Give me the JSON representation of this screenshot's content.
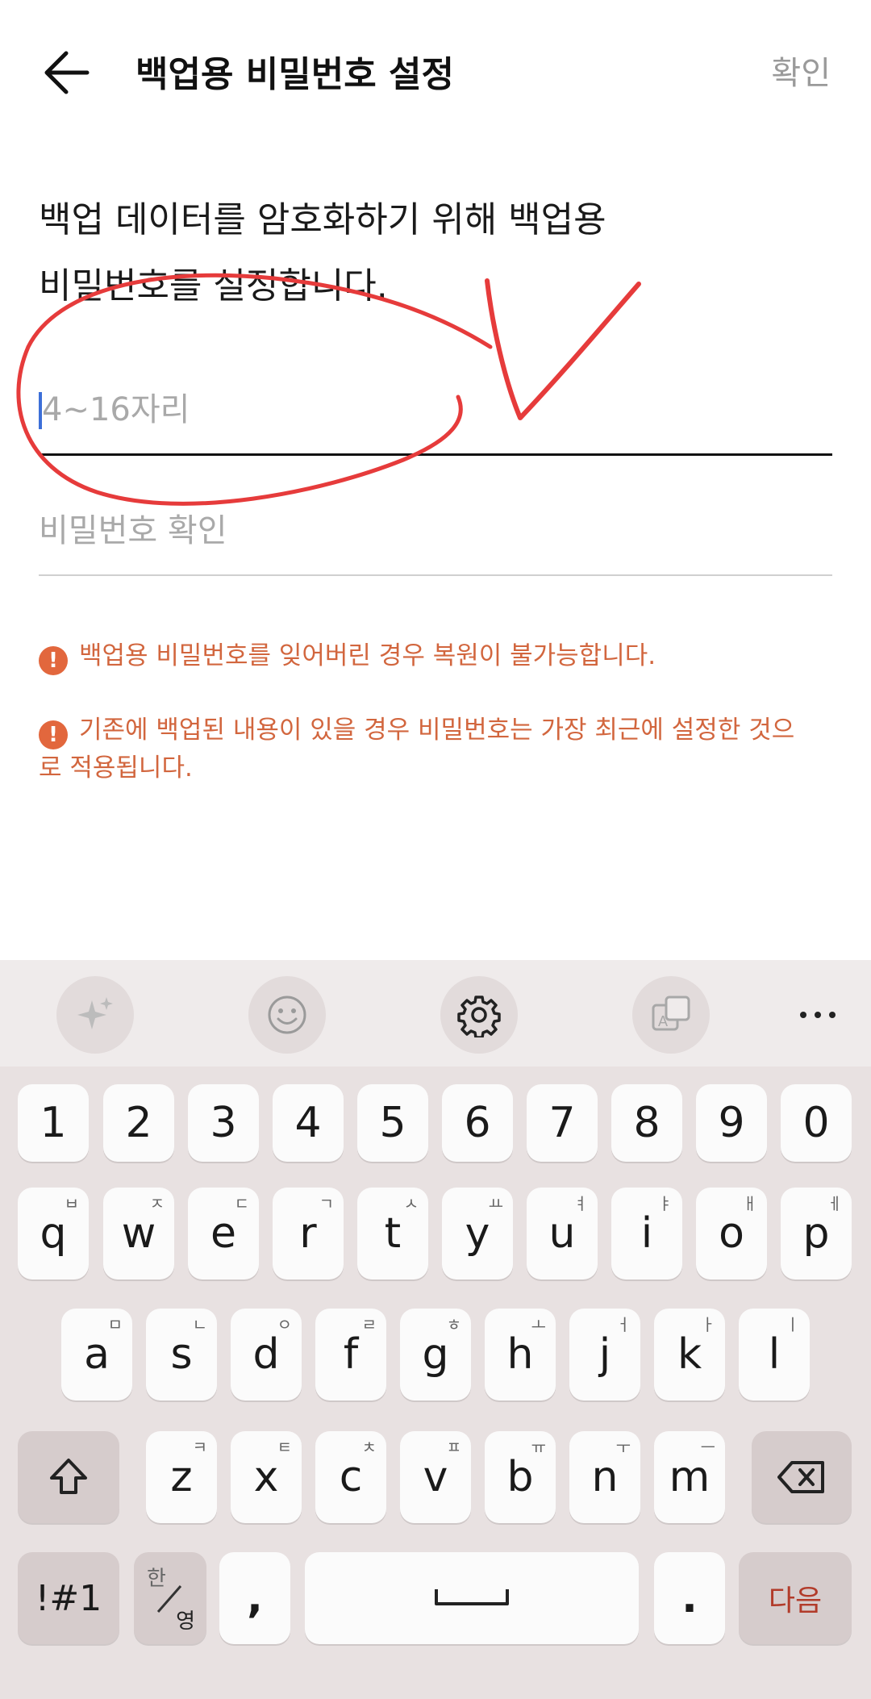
{
  "header": {
    "title": "백업용 비밀번호 설정",
    "confirm_label": "확인",
    "back_icon": "arrow-left-icon"
  },
  "description": {
    "line1": "백업 데이터를 암호화하기 위해 백업용",
    "line2": "비밀번호를 설정합니다."
  },
  "password_field": {
    "placeholder": "4~16자리",
    "value": ""
  },
  "confirm_field": {
    "placeholder": "비밀번호 확인",
    "value": ""
  },
  "warnings": [
    {
      "icon": "!",
      "text": "백업용 비밀번호를 잊어버린 경우 복원이 불가능합니다."
    },
    {
      "icon": "!",
      "text": "기존에 백업된 내용이 있을 경우 비밀번호는 가장 최근에 설정한 것으로 적용됩니다."
    }
  ],
  "annotation": {
    "color": "#e63b3b",
    "shapes": [
      "circle",
      "checkmark"
    ]
  },
  "keyboard_toolbar": {
    "icons": [
      "sparkle-icon",
      "emoji-icon",
      "settings-gear-icon",
      "translate-icon",
      "more-icon"
    ],
    "more_label": "···"
  },
  "keyboard": {
    "number_row": [
      "1",
      "2",
      "3",
      "4",
      "5",
      "6",
      "7",
      "8",
      "9",
      "0"
    ],
    "row1": [
      {
        "key": "q",
        "sub": "ㅂ"
      },
      {
        "key": "w",
        "sub": "ㅈ"
      },
      {
        "key": "e",
        "sub": "ㄷ"
      },
      {
        "key": "r",
        "sub": "ㄱ"
      },
      {
        "key": "t",
        "sub": "ㅅ"
      },
      {
        "key": "y",
        "sub": "ㅛ"
      },
      {
        "key": "u",
        "sub": "ㅕ"
      },
      {
        "key": "i",
        "sub": "ㅑ"
      },
      {
        "key": "o",
        "sub": "ㅐ"
      },
      {
        "key": "p",
        "sub": "ㅔ"
      }
    ],
    "row2": [
      {
        "key": "a",
        "sub": "ㅁ"
      },
      {
        "key": "s",
        "sub": "ㄴ"
      },
      {
        "key": "d",
        "sub": "ㅇ"
      },
      {
        "key": "f",
        "sub": "ㄹ"
      },
      {
        "key": "g",
        "sub": "ㅎ"
      },
      {
        "key": "h",
        "sub": "ㅗ"
      },
      {
        "key": "j",
        "sub": "ㅓ"
      },
      {
        "key": "k",
        "sub": "ㅏ"
      },
      {
        "key": "l",
        "sub": "ㅣ"
      }
    ],
    "row3": [
      {
        "key": "z",
        "sub": "ㅋ"
      },
      {
        "key": "x",
        "sub": "ㅌ"
      },
      {
        "key": "c",
        "sub": "ㅊ"
      },
      {
        "key": "v",
        "sub": "ㅍ"
      },
      {
        "key": "b",
        "sub": "ㅠ"
      },
      {
        "key": "n",
        "sub": "ㅜ"
      },
      {
        "key": "m",
        "sub": "ㅡ"
      }
    ],
    "symbols_label": "!#1",
    "lang_label_top": "한",
    "lang_label_bottom": "영",
    "comma_label": ",",
    "period_label": ".",
    "next_label": "다음",
    "next_color": "#b23b2a"
  }
}
